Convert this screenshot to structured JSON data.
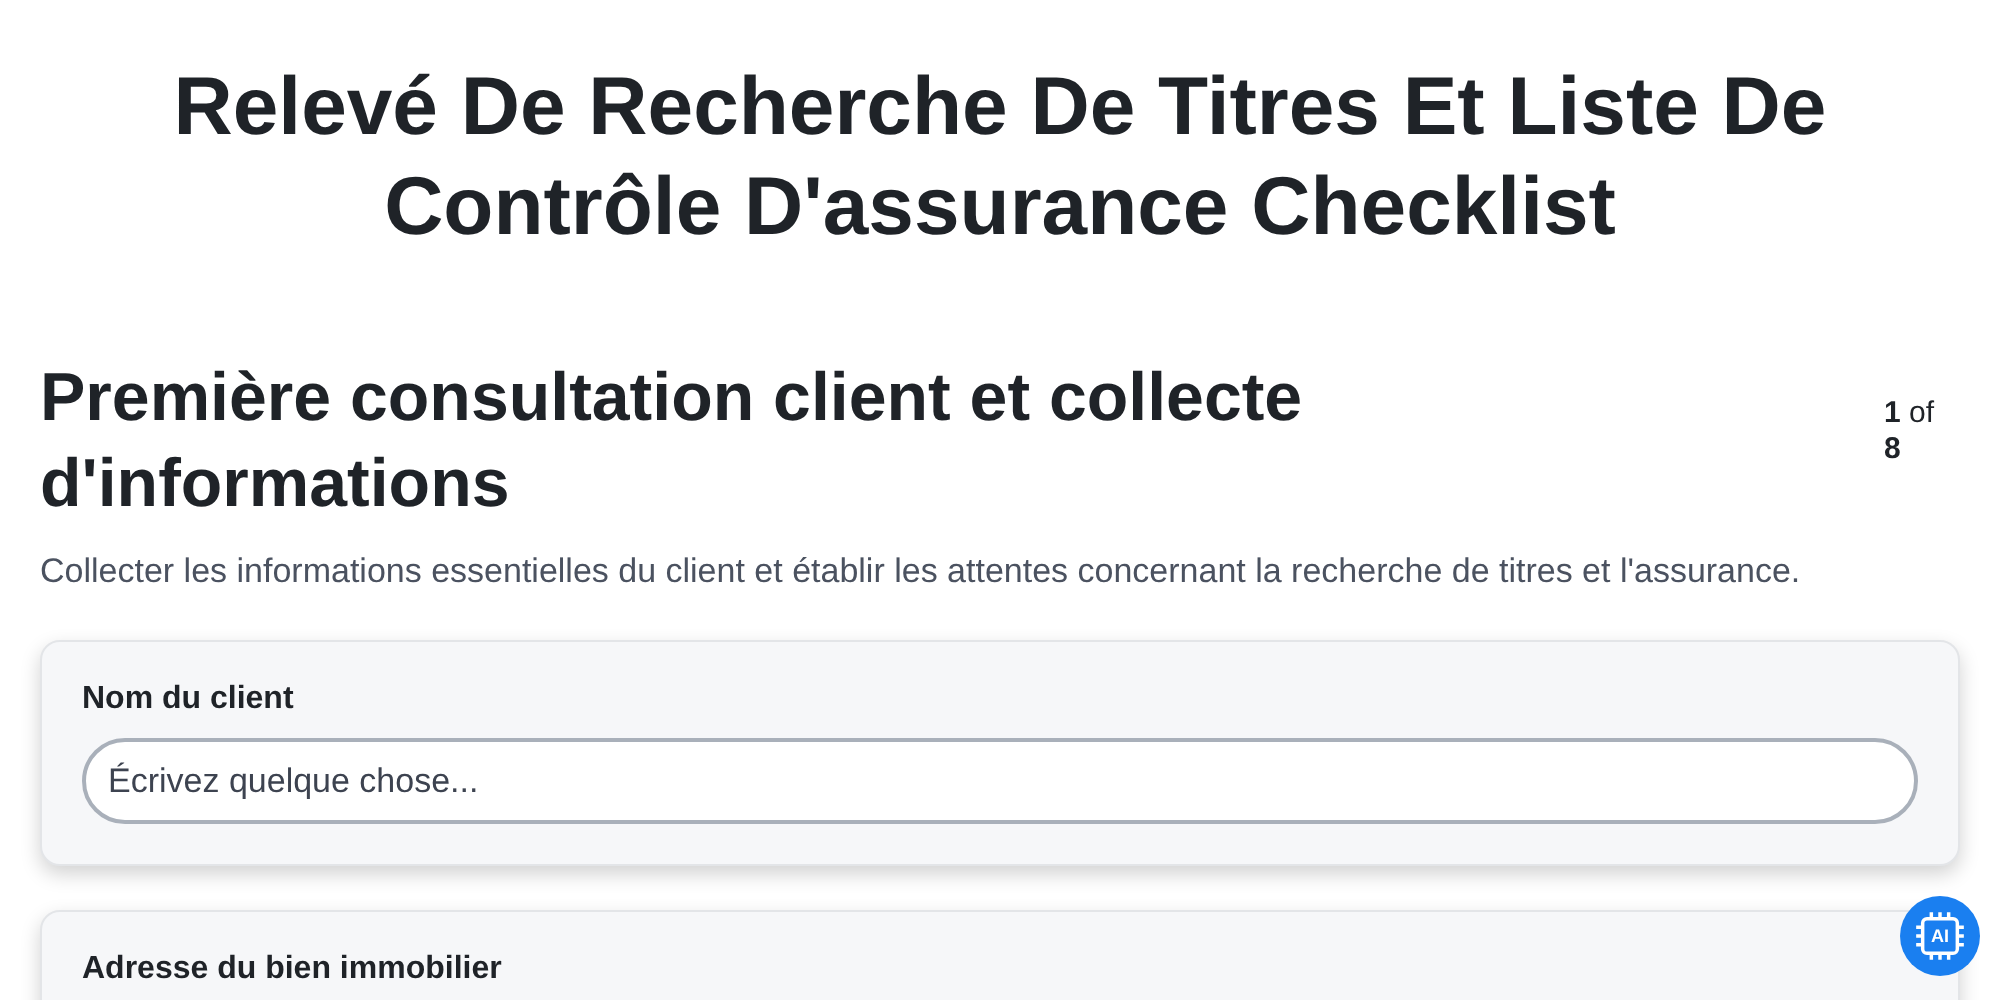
{
  "title": "Relevé De Recherche De Titres Et Liste De Contrôle D'assurance Checklist",
  "section": {
    "heading": "Première consultation client et collecte d'informations",
    "step": {
      "current": "1",
      "separator": "of",
      "total": "8"
    },
    "description": "Collecter les informations essentielles du client et établir les attentes concernant la recherche de titres et l'assurance."
  },
  "fields": [
    {
      "label": "Nom du client",
      "placeholder": "Écrivez quelque chose..."
    },
    {
      "label": "Adresse du bien immobilier"
    }
  ],
  "ai_button": {
    "label": "AI"
  }
}
